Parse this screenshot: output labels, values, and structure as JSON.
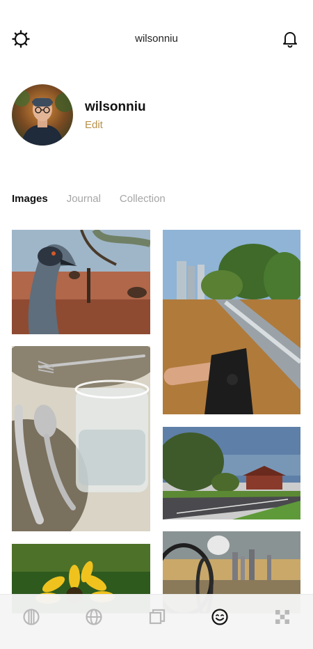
{
  "header": {
    "title": "wilsonniu",
    "left_icon": "settings-gear-icon",
    "right_icon": "notification-bell-icon"
  },
  "profile": {
    "username": "wilsonniu",
    "edit_label": "Edit",
    "avatar_icon": "user-avatar"
  },
  "tabs": [
    {
      "label": "Images",
      "active": true
    },
    {
      "label": "Journal",
      "active": false
    },
    {
      "label": "Collection",
      "active": false
    }
  ],
  "photos": [
    {
      "subject": "emu-close-up"
    },
    {
      "subject": "cutlery-and-glass"
    },
    {
      "subject": "yellow-flower"
    },
    {
      "subject": "bicycle-path-park"
    },
    {
      "subject": "suburban-street-trees"
    },
    {
      "subject": "bicycle-city-sunset"
    }
  ],
  "bottom_nav": [
    {
      "icon": "circle-lines-icon",
      "active": false
    },
    {
      "icon": "globe-icon",
      "active": false
    },
    {
      "icon": "stacked-squares-icon",
      "active": false
    },
    {
      "icon": "smiley-profile-icon",
      "active": true
    },
    {
      "icon": "checker-grid-icon",
      "active": false
    }
  ],
  "colors": {
    "accent": "#b9904a",
    "inactive_tab": "#a5a5a5",
    "nav_inactive": "#b8b8b8",
    "nav_active": "#111111"
  }
}
